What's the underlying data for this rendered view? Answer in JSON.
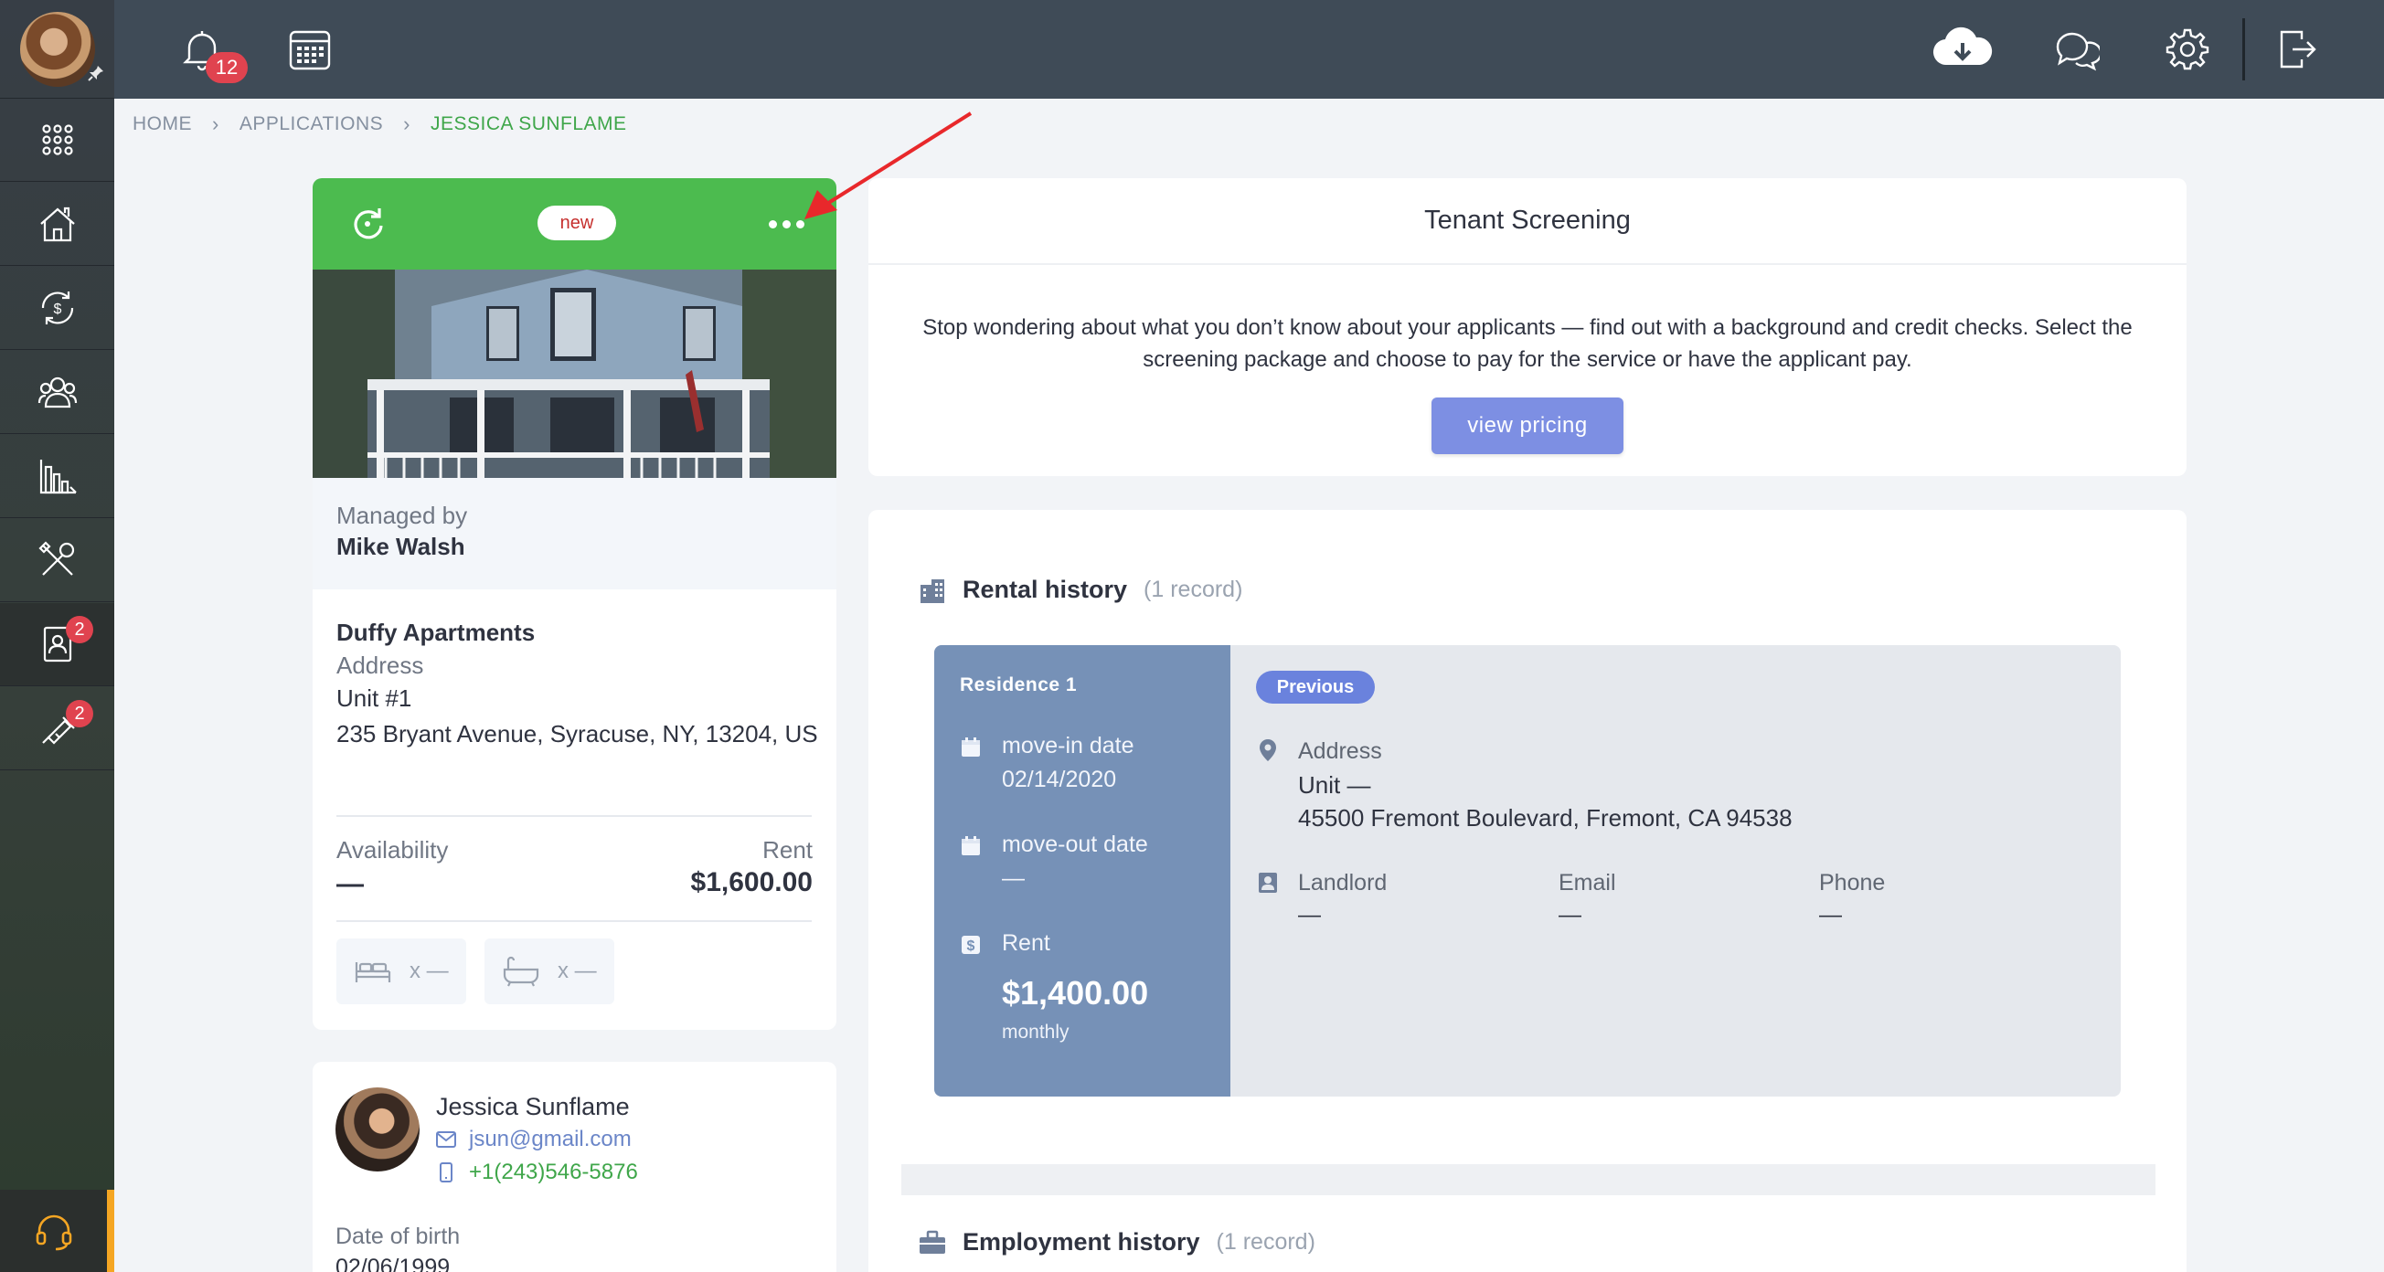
{
  "topbar": {
    "notification_count": "12"
  },
  "sidebar": {
    "applications_badge": "2",
    "tools_badge": "2"
  },
  "breadcrumb": {
    "home": "HOME",
    "applications": "APPLICATIONS",
    "current": "JESSICA SUNFLAME"
  },
  "property": {
    "status": "new",
    "managed_label": "Managed by",
    "manager": "Mike Walsh",
    "name": "Duffy Apartments",
    "address_label": "Address",
    "unit": "Unit #1",
    "street": "235 Bryant Avenue, Syracuse, NY, 13204, US",
    "availability_label": "Availability",
    "availability_value": "—",
    "rent_label": "Rent",
    "rent_value": "$1,600.00",
    "beds": "x —",
    "baths": "x —"
  },
  "applicant": {
    "name": "Jessica Sunflame",
    "email": "jsun@gmail.com",
    "phone": "+1(243)546-5876",
    "dob_label": "Date of birth",
    "dob": "02/06/1999"
  },
  "screening": {
    "title": "Tenant Screening",
    "description": "Stop wondering about what you don’t know about your applicants — find out with a background and credit checks. Select the screening package and choose to pay for the service or have the applicant pay.",
    "button": "view pricing"
  },
  "rental_history": {
    "title": "Rental history",
    "count": "(1 record)",
    "residence": {
      "title": "Residence 1",
      "move_in_label": "move-in date",
      "move_in": "02/14/2020",
      "move_out_label": "move-out date",
      "move_out": "—",
      "rent_label": "Rent",
      "rent": "$1,400.00",
      "rent_period": "monthly",
      "tag": "Previous",
      "address_label": "Address",
      "unit": "Unit —",
      "street": "45500 Fremont Boulevard, Fremont, CA 94538",
      "landlord_label": "Landlord",
      "landlord": "—",
      "email_label": "Email",
      "email": "—",
      "phone_label": "Phone",
      "phone": "—"
    }
  },
  "employment_history": {
    "title": "Employment history",
    "count": "(1 record)"
  },
  "colors": {
    "accent_green": "#4cbb4f",
    "residence_blue": "#7691b7",
    "button_blue": "#7d8fe3",
    "badge_red": "#e0434f"
  }
}
